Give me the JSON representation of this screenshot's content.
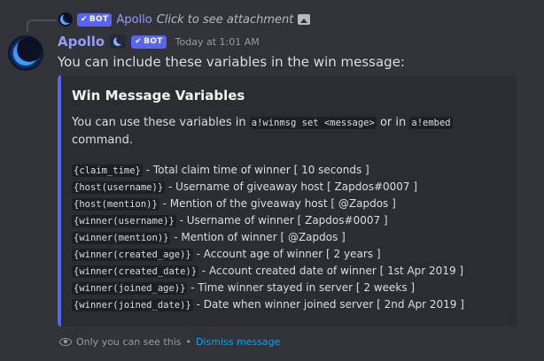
{
  "reply": {
    "author": "Apollo",
    "bot_tag": "BOT",
    "text": "Click to see attachment",
    "icon": "image-icon"
  },
  "message": {
    "author": "Apollo",
    "bot_tag": "BOT",
    "timestamp": "Today at 1:01 AM",
    "content": "You can include these variables in the win message:",
    "author_color": "#949cf7"
  },
  "embed": {
    "color": "#5865f2",
    "title": "Win Message Variables",
    "description": {
      "part1": "You can use these variables in ",
      "code1": "a!winmsg set <message>",
      "part2": " or in ",
      "code2": "a!embed",
      "part3": "command."
    },
    "variables": [
      {
        "code": "{claim_time}",
        "text": " - Total claim time of winner [ 10 seconds ]"
      },
      {
        "code": "{host(username)}",
        "text": " - Username of giveaway host [ Zapdos#0007 ]"
      },
      {
        "code": "{host(mention)}",
        "text": " - Mention of the giveaway host [ @Zapdos ]"
      },
      {
        "code": "{winner(username)}",
        "text": " - Username of winner [ Zapdos#0007 ]"
      },
      {
        "code": "{winner(mention)}",
        "text": " - Mention of winner [ @Zapdos ]"
      },
      {
        "code": "{winner(created_age)}",
        "text": " - Account age of winner [ 2 years ]"
      },
      {
        "code": "{winner(created_date)}",
        "text": " - Account created date of winner [ 1st Apr 2019 ]"
      },
      {
        "code": "{winner(joined_age)}",
        "text": " - Time winner stayed in server [ 2 weeks ]"
      },
      {
        "code": "{winner(joined_date)}",
        "text": " - Date when winner joined server [ 2nd Apr 2019 ]"
      }
    ]
  },
  "footer": {
    "note": "Only you can see this",
    "separator": " • ",
    "dismiss": "Dismiss message",
    "icon": "eye-icon"
  }
}
